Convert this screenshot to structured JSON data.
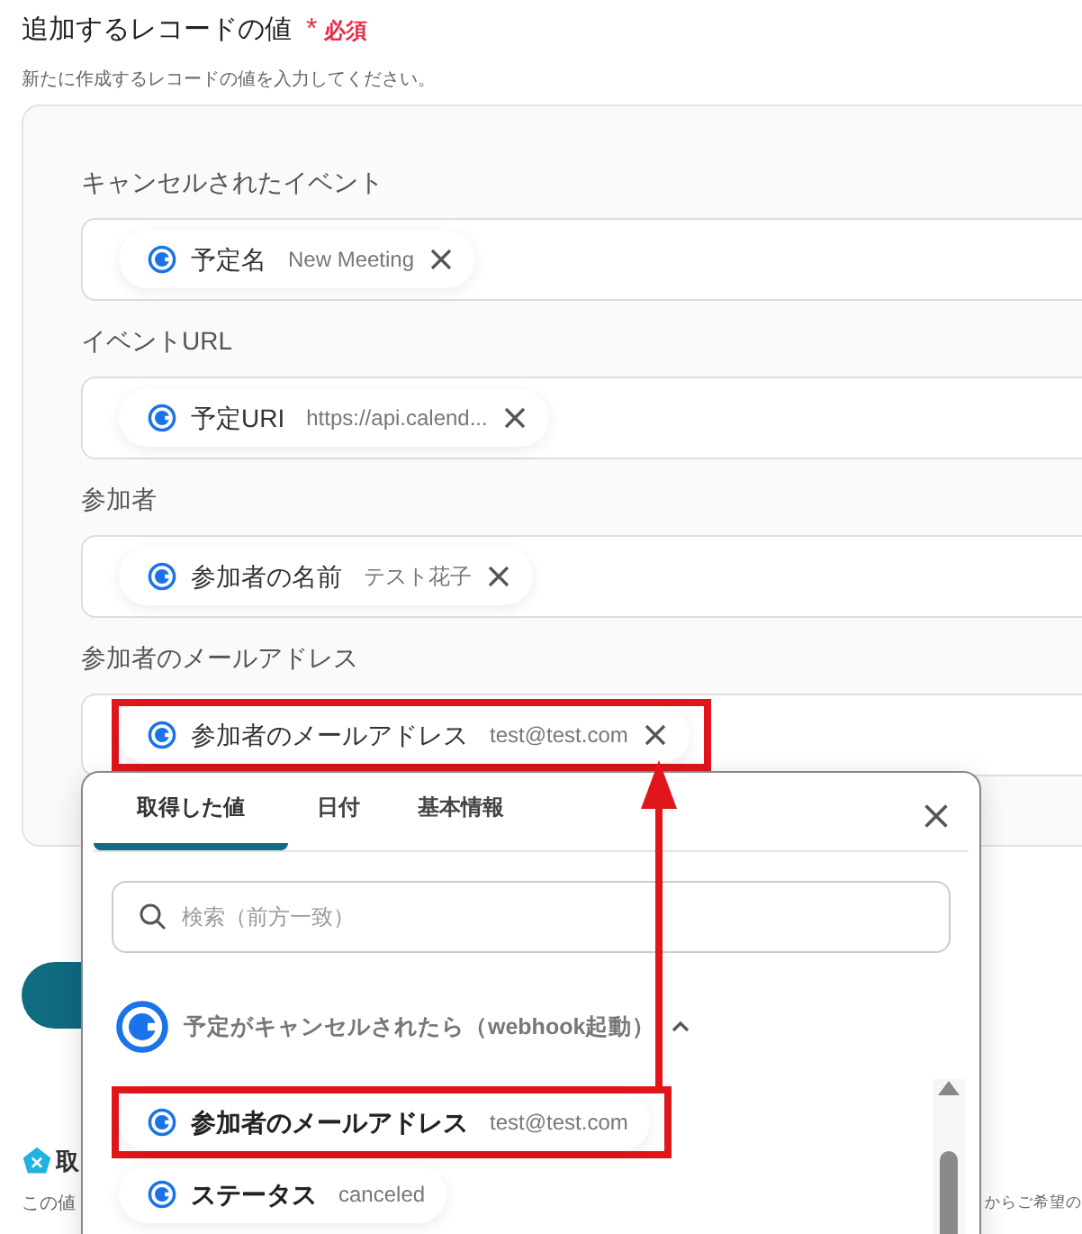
{
  "header": {
    "title": "追加するレコードの値",
    "required_mark": "*",
    "required_label": "必須",
    "description": "新たに作成するレコードの値を入力してください。"
  },
  "fields": [
    {
      "label": "キャンセルされたイベント",
      "tokens": [
        {
          "name": "予定名",
          "value": "New Meeting",
          "highlighted": false
        }
      ]
    },
    {
      "label": "イベントURL",
      "tokens": [
        {
          "name": "予定URI",
          "value": "https://api.calend...",
          "highlighted": false
        }
      ]
    },
    {
      "label": "参加者",
      "tokens": [
        {
          "name": "参加者の名前",
          "value": "テスト花子",
          "highlighted": false
        }
      ]
    },
    {
      "label": "参加者のメールアドレス",
      "tokens": [
        {
          "name": "参加者のメールアドレス",
          "value": "test@test.com",
          "highlighted": true
        }
      ]
    }
  ],
  "popup": {
    "tabs": [
      {
        "label": "取得した値",
        "selected": true
      },
      {
        "label": "日付",
        "selected": false
      },
      {
        "label": "基本情報",
        "selected": false
      }
    ],
    "search": {
      "placeholder": "検索（前方一致）"
    },
    "section": {
      "title": "予定がキャンセルされたら（webhook起動）",
      "expanded": true,
      "items": [
        {
          "name": "参加者のメールアドレス",
          "value": "test@test.com",
          "highlighted": true
        },
        {
          "name": "ステータス",
          "value": "canceled",
          "highlighted": false
        }
      ]
    }
  },
  "below": {
    "heading": "取",
    "description_start": "この値",
    "description_end": "からご希望の"
  }
}
